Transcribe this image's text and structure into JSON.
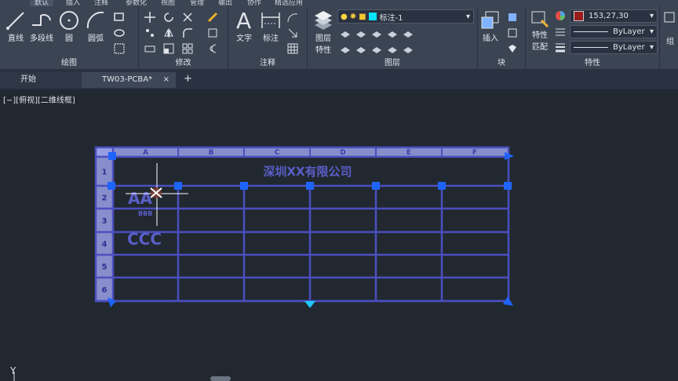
{
  "menu_tabs": [
    "默认",
    "插入",
    "注释",
    "参数化",
    "视图",
    "管理",
    "输出",
    "协作",
    "精选应用"
  ],
  "draw_panel": {
    "title": "绘图",
    "tools": [
      "直线",
      "多段线",
      "圆",
      "圆弧"
    ]
  },
  "modify_panel": {
    "title": "修改"
  },
  "annotation_panel": {
    "title": "注释",
    "tools": [
      "文字",
      "标注"
    ]
  },
  "layers_panel": {
    "title": "图层",
    "tool_label_1": "图层",
    "tool_label_2": "特性",
    "current_layer": "标注-1"
  },
  "block_panel": {
    "title": "块",
    "insert_label": "插入"
  },
  "properties_panel": {
    "title": "特性",
    "match_label_1": "特性",
    "match_label_2": "匹配",
    "color_value": "153,27,30",
    "linetype": "ByLayer",
    "lineweight": "ByLayer"
  },
  "groups_label": "组",
  "file_tabs": {
    "start": "开始",
    "drawing": "TW03-PCBA*",
    "close": "×",
    "add": "+"
  },
  "view_label": "[−][俯视][二维线框]",
  "table": {
    "columns": [
      "A",
      "B",
      "C",
      "D",
      "E",
      "F"
    ],
    "rows": [
      "1",
      "2",
      "3",
      "4",
      "5",
      "6"
    ],
    "title_text": "深圳XX有限公司",
    "cell_a2": "AA",
    "cell_a2_sub": "BBB",
    "cell_a4": "CCC"
  },
  "ucs_y": "Y",
  "colors": {
    "accent": "#1e64ff",
    "table_line": "#4b4fbf",
    "ribbon_bg": "#3b4453",
    "canvas_bg": "#212830"
  }
}
